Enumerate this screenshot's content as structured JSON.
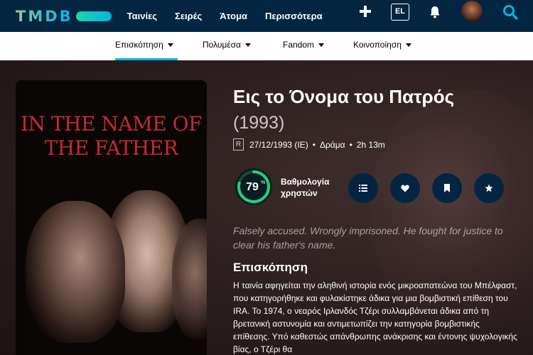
{
  "header": {
    "logo_text": "TMDB",
    "nav": [
      "Ταινίες",
      "Σειρές",
      "Άτομα",
      "Περισσότερα"
    ],
    "language": "EL",
    "icons": {
      "add": "plus-icon",
      "notifications": "bell-icon",
      "search": "search-icon"
    }
  },
  "subnav": {
    "items": [
      "Επισκόπηση",
      "Πολυμέσα",
      "Fandom",
      "Κοινοποίηση"
    ],
    "active_index": 0
  },
  "movie": {
    "poster_title": "IN THE NAME OF THE FATHER",
    "title": "Εις το Όνομα του Πατρός",
    "year": "(1993)",
    "certification": "R",
    "release": "27/12/1993 (IE)",
    "genre": "Δράμα",
    "runtime": "2h 13m",
    "user_score": 79,
    "user_score_text": "79",
    "user_score_unit": "%",
    "score_label_line1": "Βαθμολογία",
    "score_label_line2": "χρηστών",
    "actions": [
      "list-icon",
      "heart-icon",
      "bookmark-icon",
      "star-icon"
    ],
    "tagline": "Falsely accused. Wrongly imprisoned. He fought for justice to clear his father's name.",
    "overview_heading": "Επισκόπηση",
    "overview": "Η ταινία αφηγείται την αληθινή ιστορία ενός μικροαπατεώνα του Μπέλφαστ, που κατηγορήθηκε και φυλακίστηκε άδικα για μια βομβιστική επίθεση του IRA. Το 1974, ο νεαρός Ιρλανδός Τζέρι συλλαμβάνεται άδικα από τη βρετανική αστυνομία και αντιμετωπίζει την κατηγορία βομβιστικής επίθεσης. Υπό καθεστώς απάνθρωπης ανάκρισης και έντονης ψυχολογικής βίας, ο Τζέρι θα"
  },
  "colors": {
    "navbar": "#032541",
    "accent": "#01b4e4",
    "score_ring": "#21d07a",
    "score_track": "#204529"
  }
}
